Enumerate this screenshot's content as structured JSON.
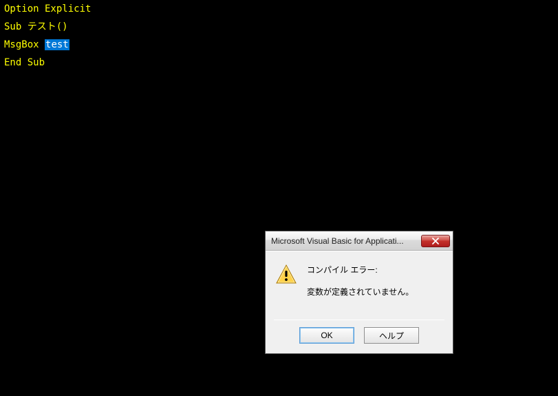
{
  "code": {
    "line1": {
      "kw": "Option Explicit"
    },
    "line2": {
      "kw": "Sub",
      "rest": " テスト()"
    },
    "line3": {
      "kw": "MsgBox ",
      "highlight": "test"
    },
    "line4": {
      "kw": "End Sub"
    }
  },
  "dialog": {
    "title": "Microsoft Visual Basic for Applicati...",
    "message1": "コンパイル エラー:",
    "message2": "変数が定義されていません。",
    "buttons": {
      "ok": "OK",
      "help": "ヘルプ"
    }
  }
}
